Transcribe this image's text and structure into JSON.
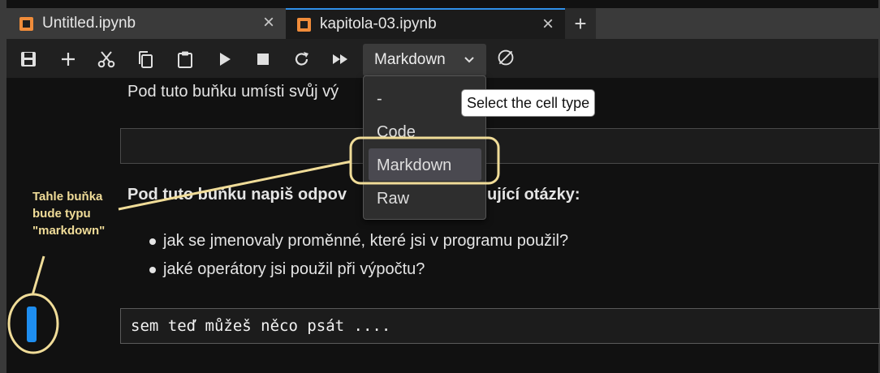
{
  "tabs": [
    {
      "label": "Untitled.ipynb",
      "active": false,
      "icon": "notebook-icon"
    },
    {
      "label": "kapitola-03.ipynb",
      "active": true,
      "icon": "notebook-icon"
    }
  ],
  "new_tab_label": "+",
  "close_label": "×",
  "toolbar": {
    "icons": [
      "save-icon",
      "add-cell-icon",
      "cut-icon",
      "copy-icon",
      "paste-icon",
      "run-icon",
      "stop-icon",
      "restart-icon",
      "run-all-icon",
      "kernel-status-icon"
    ],
    "cell_type_selected": "Markdown"
  },
  "cell_type_menu": {
    "options": [
      "-",
      "Code",
      "Markdown",
      "Raw"
    ],
    "highlighted": "Markdown",
    "tooltip": "Select the cell type"
  },
  "notebook": {
    "line1": "Pod tuto buňku umísti svůj vý",
    "heading": "Pod tuto buňku napiš odpov",
    "heading_tail": "ující otázky:",
    "bullets": [
      "jak se jmenovaly proměnné, které jsi v programu použil?",
      "jaké operátory jsi použil při výpočtu?"
    ],
    "edit_cell_text": "sem teď můžeš něco psát ...."
  },
  "annotation": {
    "lines": [
      "Tahle buňka",
      "bude typu",
      "\"markdown\""
    ],
    "color": "#f0dc98"
  },
  "colors": {
    "accent": "#2f8fe8",
    "notebook_icon": "#f08c3a",
    "active_cell_bar": "#1e8ef0"
  }
}
